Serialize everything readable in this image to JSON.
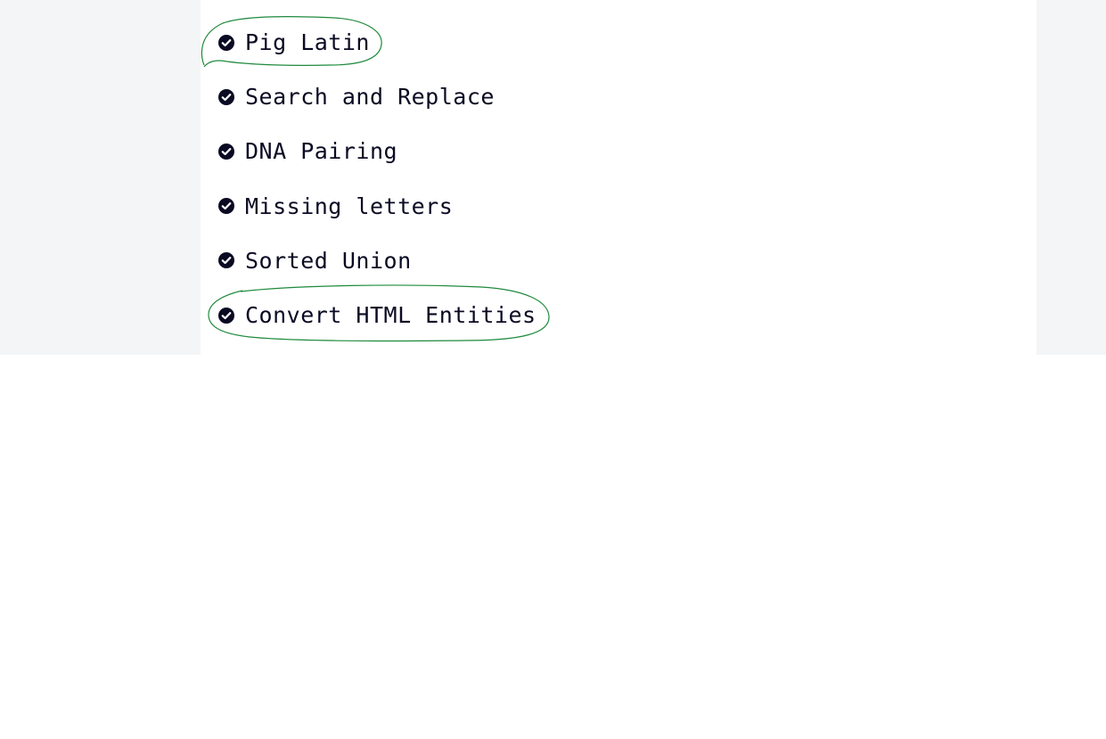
{
  "challenges": [
    {
      "label": "Pig Latin",
      "completed": true,
      "icon": "check-circle-icon"
    },
    {
      "label": "Search and Replace",
      "completed": true,
      "icon": "check-circle-icon"
    },
    {
      "label": "DNA Pairing",
      "completed": true,
      "icon": "check-circle-icon"
    },
    {
      "label": "Missing letters",
      "completed": true,
      "icon": "check-circle-icon"
    },
    {
      "label": "Sorted Union",
      "completed": true,
      "icon": "check-circle-icon"
    },
    {
      "label": "Convert HTML Entities",
      "completed": true,
      "icon": "check-circle-icon"
    }
  ],
  "colors": {
    "text": "#0a0a23",
    "side_band": "#f4f5f6",
    "annotation_stroke": "#1e8a3c"
  }
}
